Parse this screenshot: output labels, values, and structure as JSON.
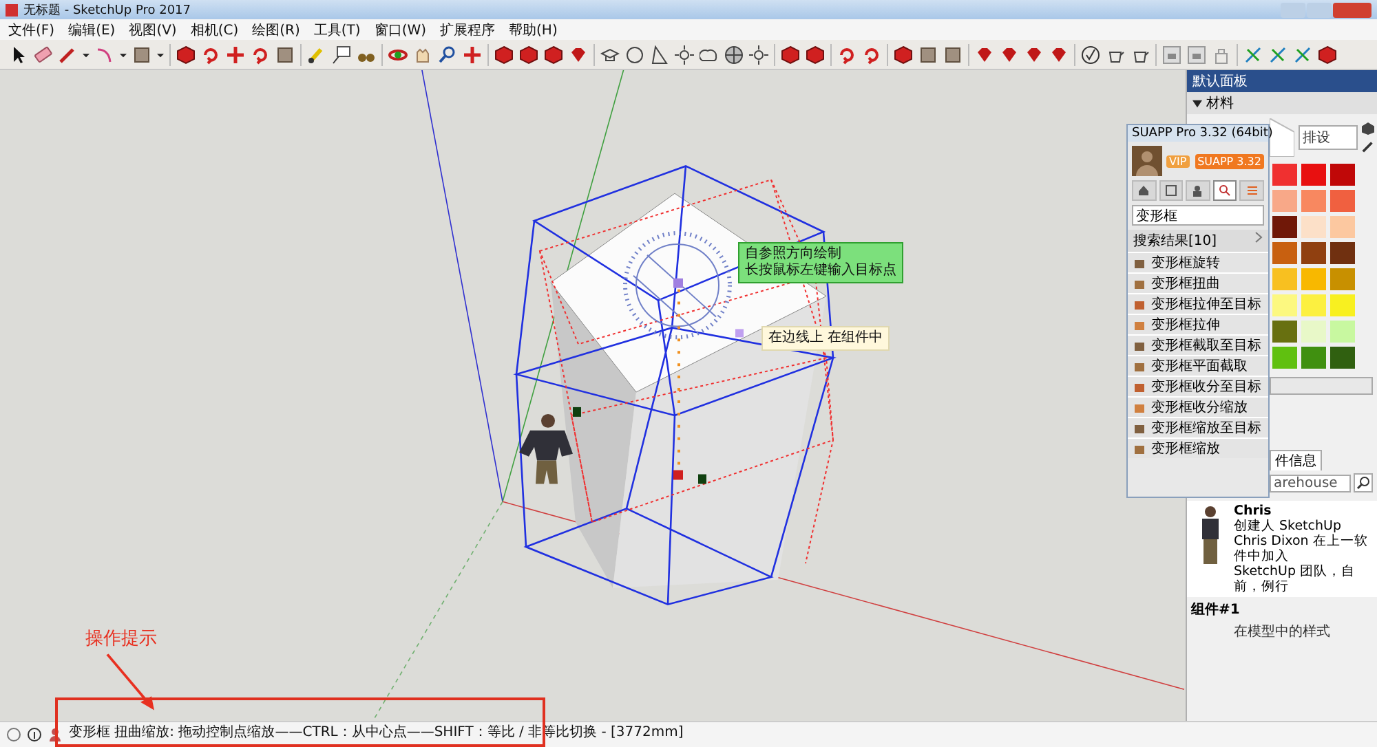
{
  "window": {
    "title": "无标题 - SketchUp Pro 2017"
  },
  "menu": [
    "文件(F)",
    "编辑(E)",
    "视图(V)",
    "相机(C)",
    "绘图(R)",
    "工具(T)",
    "窗口(W)",
    "扩展程序",
    "帮助(H)"
  ],
  "canvas": {
    "tooltips": [
      {
        "kind": "hint",
        "lines": [
          "自参照方向绘制",
          "长按鼠标左键输入目标点"
        ]
      },
      {
        "kind": "inference",
        "lines": [
          "在边线上  在组件中"
        ]
      }
    ]
  },
  "suapp_panel": {
    "title": "SUAPP Pro 3.32 (64bit)",
    "badge": "VIP",
    "version_button": "SUAPP 3.32",
    "tabs": [
      {
        "selected": false
      },
      {
        "selected": false
      },
      {
        "selected": false
      },
      {
        "selected": true
      },
      {
        "selected": false
      }
    ],
    "search": {
      "value": "变形框"
    },
    "results_header": "搜索结果[10]",
    "results": [
      "变形框旋转",
      "变形框扭曲",
      "变形框拉伸至目标",
      "变形框拉伸",
      "变形框截取至目标",
      "变形框平面截取",
      "变形框收分至目标",
      "变形框收分缩放",
      "变形框缩放至目标",
      "变形框缩放"
    ]
  },
  "tray": {
    "title": "默认面板",
    "materials": {
      "title": "材料",
      "name_field": "排设",
      "swatches": [
        {
          "color": "#f03030"
        },
        {
          "color": "#e81010"
        },
        {
          "color": "#c00808"
        },
        {
          "color": "#f8a888"
        },
        {
          "color": "#f88860"
        },
        {
          "color": "#f06040"
        },
        {
          "color": "#701808"
        },
        {
          "color": "#fce0c8"
        },
        {
          "color": "#fcc8a0"
        },
        {
          "color": "#c86010"
        },
        {
          "color": "#904010"
        },
        {
          "color": "#703010"
        },
        {
          "color": "#f8c020"
        },
        {
          "color": "#f8b800"
        },
        {
          "color": "#c89000"
        },
        {
          "color": "#fcf880"
        },
        {
          "color": "#fcf040"
        },
        {
          "color": "#f8f020"
        },
        {
          "color": "#687010"
        },
        {
          "color": "#e8f8c8"
        },
        {
          "color": "#c8f8a0"
        },
        {
          "color": "#60c010"
        },
        {
          "color": "#409010"
        },
        {
          "color": "#306010"
        }
      ]
    },
    "components": {
      "tab": "件信息",
      "search_value": "arehouse",
      "name": "Chris",
      "lines": [
        "创建人 SketchUp",
        "Chris Dixon 在上一软件中加入",
        "SketchUp 团队，自前，例行"
      ],
      "component": "组件#1",
      "style": "在模型中的样式"
    }
  },
  "status_bar": {
    "text": "变形框 扭曲缩放: 拖动控制点缩放——CTRL：从中心点——SHIFT：等比 / 非等比切换 - [3772mm]"
  },
  "annotation": {
    "label": "操作提示"
  }
}
